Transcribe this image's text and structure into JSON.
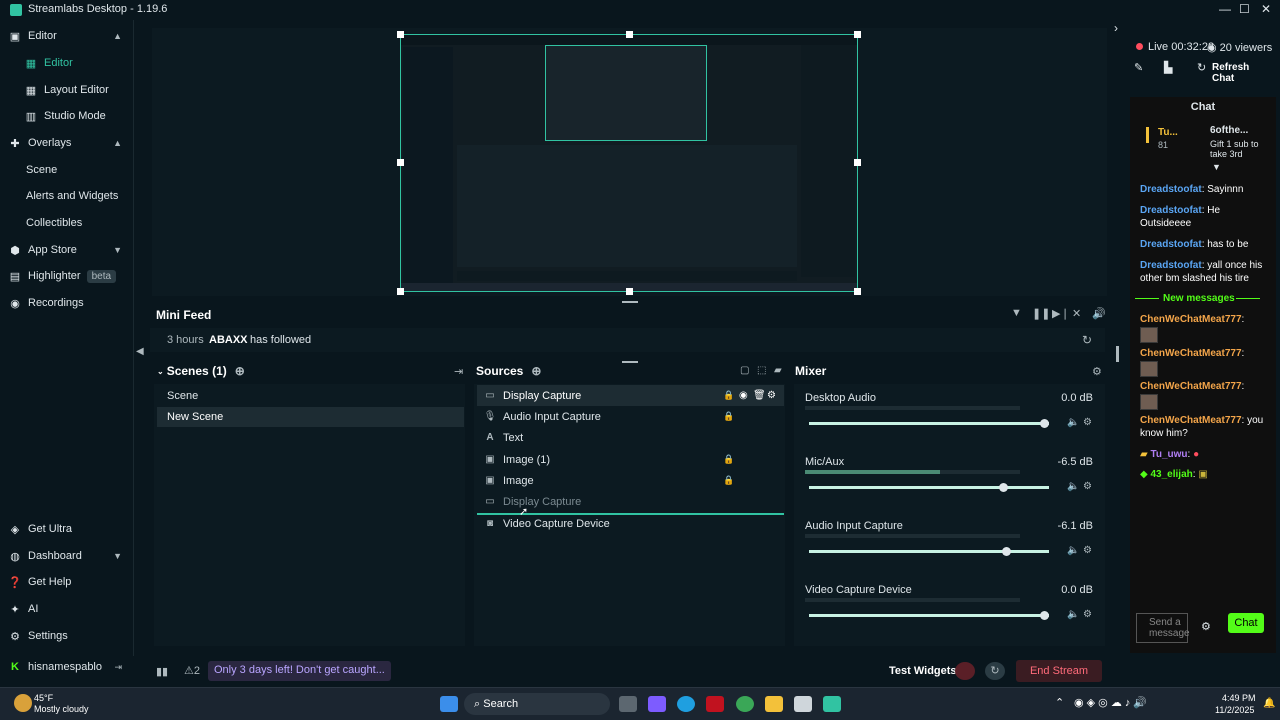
{
  "window": {
    "title": "Streamlabs Desktop - 1.19.6",
    "min": "—",
    "max": "☐",
    "close": "✕"
  },
  "sidebar": {
    "editor": "Editor",
    "editor_sub": [
      "Editor",
      "Layout Editor",
      "Studio Mode"
    ],
    "overlays": "Overlays",
    "overlays_sub": [
      "Scene",
      "Alerts and Widgets",
      "Collectibles"
    ],
    "app_store": "App Store",
    "highlighter": "Highlighter",
    "beta": "beta",
    "recordings": "Recordings",
    "get_ultra": "Get Ultra",
    "dashboard": "Dashboard",
    "get_help": "Get Help",
    "ai": "AI",
    "settings": "Settings",
    "username": "hisnamespablo"
  },
  "minifeed": {
    "title": "Mini Feed",
    "time": "3 hours",
    "user": "ABAXX",
    "action": "has followed"
  },
  "scenes": {
    "title": "Scenes (1)",
    "items": [
      "Scene",
      "New Scene"
    ]
  },
  "sources": {
    "title": "Sources",
    "items": [
      "Display Capture",
      "Audio Input Capture",
      "Text",
      "Image (1)",
      "Image",
      "Display Capture",
      "Video Capture Device"
    ]
  },
  "mixer": {
    "title": "Mixer",
    "channels": [
      {
        "name": "Desktop Audio",
        "db": "0.0 dB",
        "volume": 0.98
      },
      {
        "name": "Mic/Aux",
        "db": "-6.5 dB",
        "volume": 0.81,
        "level": 0.63
      },
      {
        "name": "Audio Input Capture",
        "db": "-6.1 dB",
        "volume": 0.82
      },
      {
        "name": "Video Capture Device",
        "db": "0.0 dB",
        "volume": 0.98
      }
    ]
  },
  "footer": {
    "notif_count": "2",
    "promo": "Only 3 days left! Don't get caught...",
    "test_widgets": "Test Widgets",
    "end_stream": "End Stream"
  },
  "chat": {
    "live": "Live",
    "time": "00:32:28",
    "viewers": "20 viewers",
    "refresh": "Refresh Chat",
    "title": "Chat",
    "pinned_user": "Tu...",
    "pinned_count": "81",
    "pinned_title": "6ofthe...",
    "pinned_text": "Gift 1 sub to take 3rd",
    "messages": [
      {
        "user": "Dreadstoofat",
        "text": ": Sayinnn"
      },
      {
        "user": "Dreadstoofat",
        "text": ": He Outsideeee"
      },
      {
        "user": "Dreadstoofat",
        "text": ": has to be"
      },
      {
        "user": "Dreadstoofat",
        "text": ": yall once his other bm slashed his tire"
      }
    ],
    "new_messages": "New messages",
    "new": [
      {
        "user": "ChenWeChatMeat777",
        "text": ":"
      },
      {
        "user": "ChenWeChatMeat777",
        "text": ":"
      },
      {
        "user": "ChenWeChatMeat777",
        "text": ":"
      },
      {
        "user": "ChenWeChatMeat777",
        "text": ": you know him?"
      }
    ],
    "tu": "Tu_uwu",
    "elijah": "43_elijah",
    "placeholder": "Send a message",
    "send": "Chat"
  },
  "taskbar": {
    "temp": "45°F",
    "weather": "Mostly cloudy",
    "search": "Search",
    "time": "4:49 PM",
    "date": "11/2/2025"
  }
}
